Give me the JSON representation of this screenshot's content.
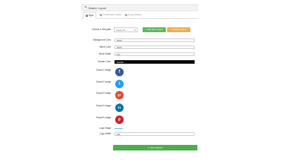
{
  "header": {
    "title": "Master Layout",
    "icon": "pencil-icon"
  },
  "tabs": [
    {
      "label": "Style",
      "icon": "style-icon"
    },
    {
      "label": "Conversion Codes",
      "icon": "code-icon"
    },
    {
      "label": "Cross Selling",
      "icon": "cart-icon"
    }
  ],
  "template": {
    "label": "Choose a Template",
    "selected": "Layout 10",
    "add_button": "Add New Layout",
    "edit_button": "Edit Template"
  },
  "fields": {
    "background_color": {
      "label": "Background Color",
      "value": "f6f6f6"
    },
    "block_color": {
      "label": "Block Color",
      "value": "f6f6f6"
    },
    "block_width": {
      "label": "Block Width",
      "value": "640"
    },
    "border_color": {
      "label": "Border Color",
      "value": "000000"
    }
  },
  "social": [
    {
      "label": "Social 1 Image",
      "icon": "facebook-icon",
      "glyph": "f",
      "color": "#3b5998"
    },
    {
      "label": "Social 2 Image",
      "icon": "twitter-icon",
      "glyph": "t",
      "color": "#1da1f2"
    },
    {
      "label": "Social 3 Image",
      "icon": "google-plus-icon",
      "glyph": "g+",
      "color": "#dd4b39"
    },
    {
      "label": "Social 4 Image",
      "icon": "linkedin-icon",
      "glyph": "in",
      "color": "#0e76a8"
    },
    {
      "label": "Social 5 Image",
      "icon": "pinterest-icon",
      "glyph": "p",
      "color": "#cb2027"
    }
  ],
  "logo": {
    "image_label": "Logo Image",
    "width_label": "Logo Width",
    "width_value": "200"
  },
  "save_button": "Save Options",
  "colors": {
    "primary_green": "#5cb85c",
    "orange": "#f0ad4e",
    "save_green": "#4cae4c"
  }
}
